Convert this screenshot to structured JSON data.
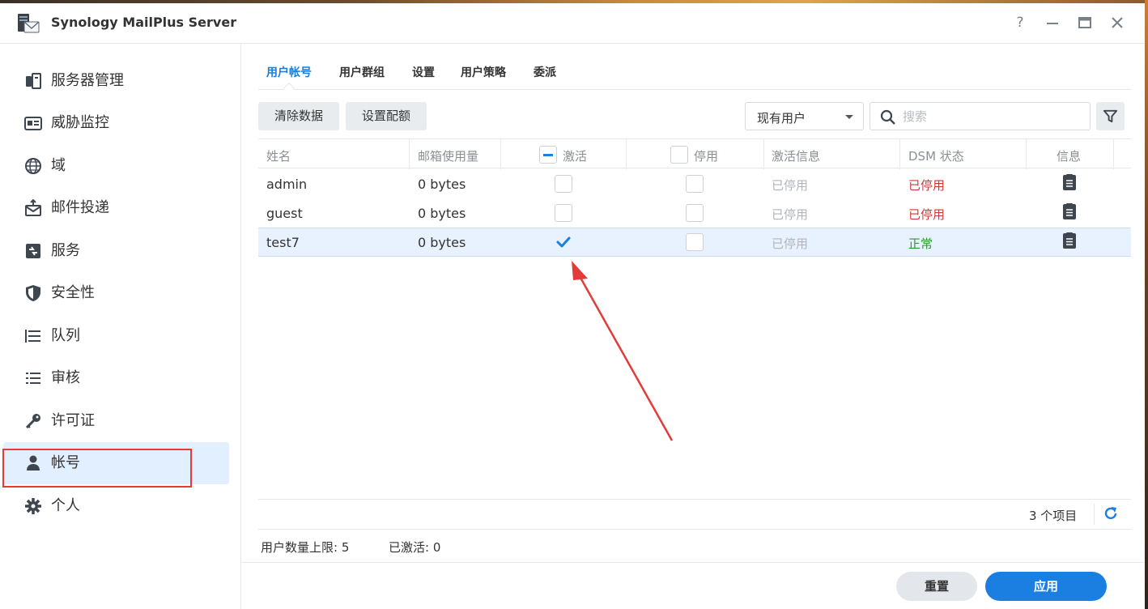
{
  "window": {
    "title": "Synology MailPlus Server",
    "controls": [
      "?",
      "minimize-icon",
      "maximize-icon",
      "close-icon"
    ]
  },
  "sidebar": {
    "items": [
      {
        "label": "服务器管理",
        "icon": "server-icon"
      },
      {
        "label": "威胁监控",
        "icon": "threat-monitor-icon"
      },
      {
        "label": "域",
        "icon": "globe-icon"
      },
      {
        "label": "邮件投递",
        "icon": "mail-delivery-icon"
      },
      {
        "label": "服务",
        "icon": "service-icon"
      },
      {
        "label": "安全性",
        "icon": "shield-icon"
      },
      {
        "label": "队列",
        "icon": "queue-icon"
      },
      {
        "label": "审核",
        "icon": "audit-list-icon"
      },
      {
        "label": "许可证",
        "icon": "key-icon"
      },
      {
        "label": "帐号",
        "icon": "user-icon",
        "active": true
      },
      {
        "label": "个人",
        "icon": "gear-icon"
      }
    ]
  },
  "tabs": [
    {
      "label": "用户帐号",
      "active": true
    },
    {
      "label": "用户群组"
    },
    {
      "label": "设置"
    },
    {
      "label": "用户策略"
    },
    {
      "label": "委派"
    }
  ],
  "toolbar": {
    "clear_data": "清除数据",
    "set_quota": "设置配额",
    "filter_select": "现有用户",
    "search_placeholder": "搜索"
  },
  "table": {
    "headers": {
      "name": "姓名",
      "mailbox_usage": "邮箱使用量",
      "activate": "激活",
      "disable": "停用",
      "activation_info": "激活信息",
      "dsm_status": "DSM 状态",
      "info": "信息"
    },
    "header_activate_state": "indeterminate",
    "header_disable_state": "unchecked",
    "rows": [
      {
        "name": "admin",
        "usage": "0 bytes",
        "activated": false,
        "disabled": false,
        "activation_info": "已停用",
        "dsm_status": "已停用",
        "dsm_status_color": "#d33636"
      },
      {
        "name": "guest",
        "usage": "0 bytes",
        "activated": false,
        "disabled": false,
        "activation_info": "已停用",
        "dsm_status": "已停用",
        "dsm_status_color": "#d33636"
      },
      {
        "name": "test7",
        "usage": "0 bytes",
        "activated": true,
        "disabled": false,
        "activation_info": "已停用",
        "dsm_status": "正常",
        "dsm_status_color": "#2a9a2a",
        "selected": true
      }
    ]
  },
  "footer": {
    "item_count": "3 个项目",
    "user_limit": "用户数量上限: 5",
    "activated": "已激活: 0",
    "reset": "重置",
    "apply": "应用"
  },
  "colors": {
    "accent": "#1a7fe0",
    "active_tab": "#1b7ed8",
    "sidebar_active": "#e2efff",
    "annotation_red": "#e33b3b"
  }
}
